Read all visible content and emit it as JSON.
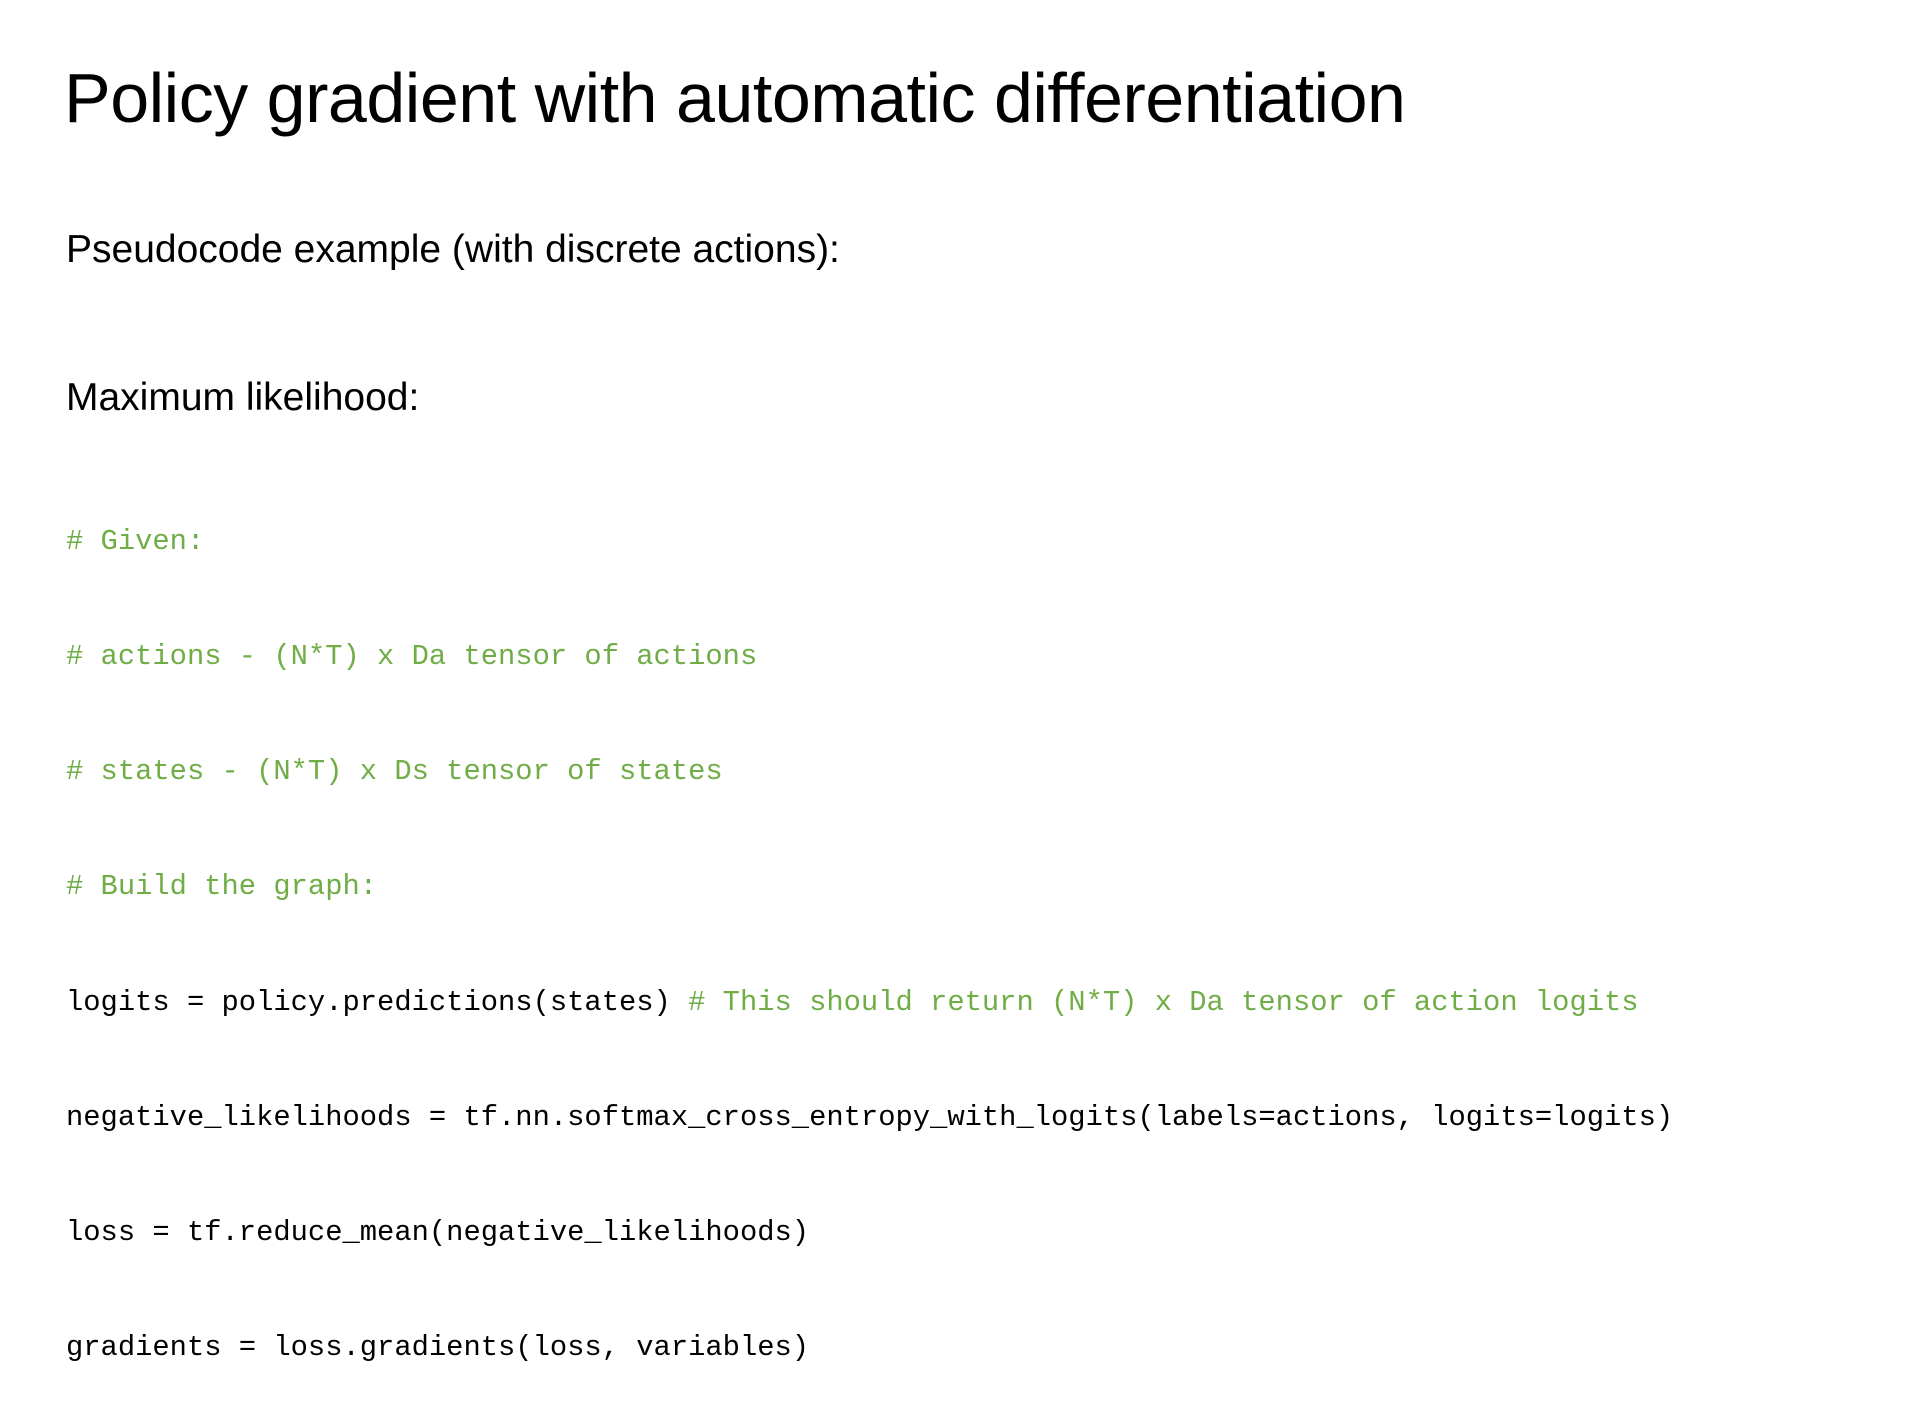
{
  "slide": {
    "title": "Policy gradient with automatic differentiation",
    "subtitle": "Pseudocode example (with discrete actions):",
    "section": "Maximum likelihood:",
    "comment_color": "#70ad47",
    "code": {
      "comment_given": "# Given:",
      "comment_actions": "# actions - (N*T) x Da tensor of actions",
      "comment_states": "# states - (N*T) x Ds tensor of states",
      "comment_build": "# Build the graph:",
      "logits_code": "logits = policy.predictions(states) ",
      "logits_comment": "# This should return (N*T) x Da tensor of action logits",
      "neg_likelihoods": "negative_likelihoods = tf.nn.softmax_cross_entropy_with_logits(labels=actions, logits=logits)",
      "loss": "loss = tf.reduce_mean(negative_likelihoods)",
      "gradients": "gradients = loss.gradients(loss, variables)"
    }
  }
}
